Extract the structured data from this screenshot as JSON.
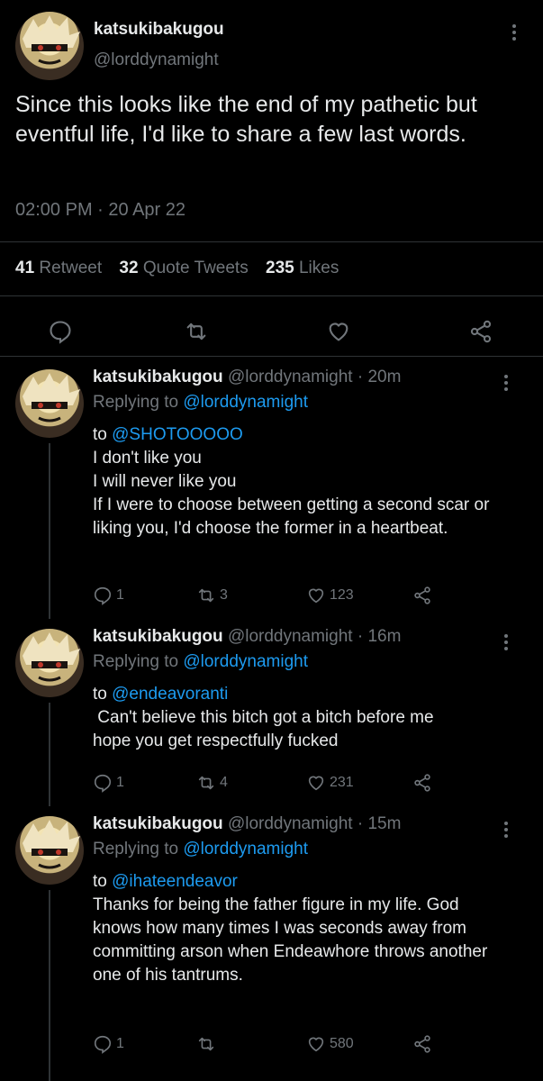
{
  "main_tweet": {
    "display_name": "katsukibakugou",
    "handle": "@lorddynamight",
    "text": "Since this looks like the end of my pathetic but eventful life, I'd like to share a few last words.",
    "time": "02:00 PM · 20 Apr 22",
    "stats": [
      {
        "count": "41",
        "label": "Retweet"
      },
      {
        "count": "32",
        "label": "Quote Tweets"
      },
      {
        "count": "235",
        "label": "Likes"
      }
    ],
    "actions": [
      "reply-icon",
      "retweet-icon",
      "like-icon",
      "share-icon"
    ]
  },
  "replies": [
    {
      "display_name": "katsukibakugou",
      "handle": "@lorddynamight",
      "age": "· 20m",
      "replying_prefix": "Replying to",
      "replying_to": "@lorddynamight",
      "to_prefix": "to",
      "mention": "@SHOTOOOOO",
      "lines": [
        "I don't like you",
        "I will never like you",
        "If I were to choose between getting a second scar or liking you, I'd choose the former in a heartbeat."
      ],
      "reply_count": "1",
      "retweet_count": "3",
      "like_count": "123"
    },
    {
      "display_name": "katsukibakugou",
      "handle": "@lorddynamight",
      "age": "· 16m",
      "replying_prefix": "Replying to",
      "replying_to": "@lorddynamight",
      "to_prefix": "to",
      "mention": "@endeavoranti",
      "lines": [
        " Can't believe this bitch got a bitch before me",
        "hope you get respectfully fucked"
      ],
      "reply_count": "1",
      "retweet_count": "4",
      "like_count": "231"
    },
    {
      "display_name": "katsukibakugou",
      "handle": "@lorddynamight",
      "age": "· 15m",
      "replying_prefix": "Replying to",
      "replying_to": "@lorddynamight",
      "to_prefix": "to",
      "mention": "@ihateendeavor",
      "lines": [
        "Thanks for being the father figure in my life. God knows how many times I was seconds away from committing arson when Endeawhore throws another one of his tantrums."
      ],
      "reply_count": "1",
      "retweet_count": "",
      "like_count": "580"
    }
  ],
  "colors": {
    "background": "#000000",
    "text": "#e7e9ea",
    "secondary": "#71767b",
    "link": "#1d9bf0",
    "divider": "#2f3336"
  }
}
